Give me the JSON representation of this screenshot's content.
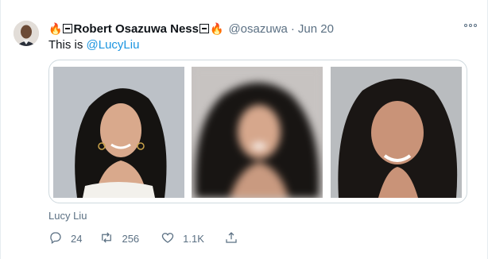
{
  "tweet": {
    "display_name_prefix_emoji": "🔥",
    "display_name": "Robert Osazuwa Ness",
    "display_name_suffix_emoji": "🔥",
    "handle": "@osazuwa",
    "separator": "·",
    "date": "Jun 20",
    "text_prefix": "This is ",
    "mention": "@LucyLiu"
  },
  "media": {
    "images": [
      {
        "name": "original-photo",
        "blurred": false
      },
      {
        "name": "pixelated-photo",
        "blurred": true
      },
      {
        "name": "reconstructed-photo",
        "blurred": false
      }
    ],
    "caption": "Lucy Liu"
  },
  "actions": {
    "reply_count": "24",
    "retweet_count": "256",
    "like_count": "1.1K"
  },
  "icons": [
    "reply-icon",
    "retweet-icon",
    "like-icon",
    "share-icon",
    "more-icon"
  ],
  "colors": {
    "link": "#1b95e0",
    "secondary_text": "#5b7083",
    "border": "#cfd9de",
    "emoji_fire": "#f4900c"
  }
}
